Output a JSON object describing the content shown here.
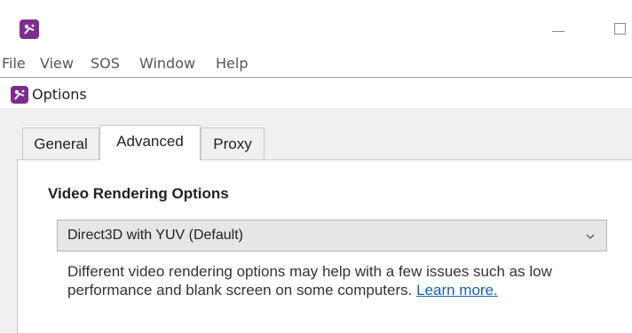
{
  "colors": {
    "brand": "#7c2d8e",
    "link": "#1a5fb4",
    "dialog_background": "#f0f0f0"
  },
  "icons": {
    "app": "app-logo-icon",
    "minimize": "minimize-icon",
    "maximize": "maximize-icon",
    "dropdown": "chevron-down-icon"
  },
  "menu": [
    "File",
    "View",
    "SOS",
    "Window",
    "Help"
  ],
  "dialog": {
    "title": "Options",
    "tabs": [
      "General",
      "Advanced",
      "Proxy"
    ],
    "active_tab": "Advanced"
  },
  "advanced": {
    "section_title": "Video Rendering Options",
    "renderer_selected": "Direct3D with YUV (Default)",
    "description": "Different video rendering options may help with a few issues such as low performance and blank screen on some computers.",
    "link_text": "Learn more."
  }
}
